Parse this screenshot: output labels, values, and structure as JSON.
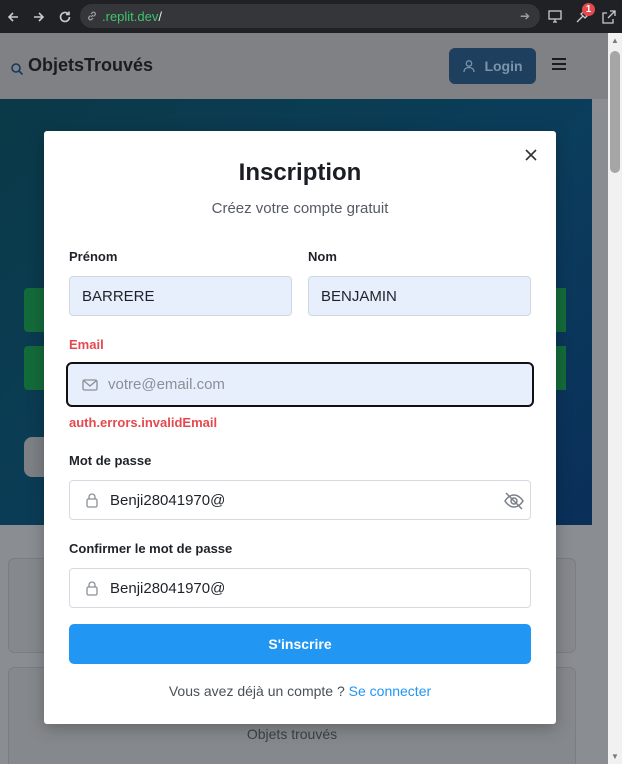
{
  "browser": {
    "url_host": ".replit.dev",
    "url_path": "/",
    "notification_count": "1"
  },
  "site": {
    "logo_text": "ObjetsTrouvés",
    "login_label": "Login",
    "lower_card_label": "Objets trouvés"
  },
  "modal": {
    "title": "Inscription",
    "subtitle": "Créez votre compte gratuit",
    "first_name": {
      "label": "Prénom",
      "value": "BARRERE"
    },
    "last_name": {
      "label": "Nom",
      "value": "BENJAMIN"
    },
    "email": {
      "label": "Email",
      "placeholder": "votre@email.com",
      "error": "auth.errors.invalidEmail"
    },
    "password": {
      "label": "Mot de passe",
      "value": "Benji28041970@"
    },
    "confirm_password": {
      "label": "Confirmer le mot de passe",
      "value": "Benji28041970@"
    },
    "submit_label": "S'inscrire",
    "have_account_text": "Vous avez déjà un compte ?",
    "login_link": "Se connecter"
  },
  "colors": {
    "primary": "#2196f3",
    "error": "#e5484d",
    "filled_input": "#e8effc"
  }
}
